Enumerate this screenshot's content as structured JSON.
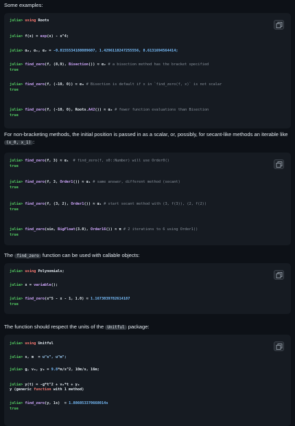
{
  "intro": "Some examples:",
  "para2": "For non-bracketing methods, the initial position is passed in as a scalar, or, possibly, for secant-like methods an iterable like ",
  "para2_code": "(x_0, x_1)",
  "para2_end": ":",
  "para3_pre": "The ",
  "para3_code": "find_zero",
  "para3_post": " function can be used with callable objects:",
  "para4_pre": "The function should respect the units of the ",
  "para4_code": "Unitful",
  "para4_post": " package:",
  "copy_icon": "copy-icon",
  "prompt": "julia>",
  "blocks": [
    {
      "lines": [
        [
          {
            "t": "julia> ",
            "c": "pr"
          },
          {
            "t": "using",
            "c": "kw"
          },
          {
            "t": " Roots",
            "c": "plain"
          }
        ],
        [
          {
            "t": "julia> ",
            "c": "pr"
          },
          {
            "t": "f(x) = ",
            "c": "plain"
          },
          {
            "t": "exp",
            "c": "fn"
          },
          {
            "t": "(x) - x^4;",
            "c": "plain"
          }
        ],
        [
          {
            "t": "julia> ",
            "c": "pr"
          },
          {
            "t": "α₀, α₁, α₂ = ",
            "c": "plain"
          },
          {
            "t": "-0.8155534188089607, 1.4296118247255556, 8.6131694564414;",
            "c": "num"
          }
        ],
        [
          {
            "t": "julia> ",
            "c": "pr"
          },
          {
            "t": "find_zero",
            "c": "fn"
          },
          {
            "t": "(f, (8,9), ",
            "c": "plain"
          },
          {
            "t": "Bisection",
            "c": "fn"
          },
          {
            "t": "()) ≈ α₂ ",
            "c": "plain"
          },
          {
            "t": "# a bisection method has the bracket specified",
            "c": "cm"
          }
        ],
        [
          {
            "t": "true",
            "c": "out"
          }
        ],
        [
          {
            "t": "julia> ",
            "c": "pr"
          },
          {
            "t": "find_zero",
            "c": "fn"
          },
          {
            "t": "(f, (-10, 0)) ≈ α₀ ",
            "c": "plain"
          },
          {
            "t": "# Bisection is default if x in `find_zero(f, x)` is not scalar",
            "c": "cm"
          }
        ],
        [
          {
            "t": "true",
            "c": "out"
          }
        ],
        [
          {
            "t": "julia> ",
            "c": "pr"
          },
          {
            "t": "find_zero",
            "c": "fn"
          },
          {
            "t": "(f, (-10, 0), Roots.",
            "c": "plain"
          },
          {
            "t": "A42",
            "c": "fn"
          },
          {
            "t": "()) ≈ α₀ ",
            "c": "plain"
          },
          {
            "t": "# fewer function evaluations than Bisection",
            "c": "cm"
          }
        ],
        [
          {
            "t": "true",
            "c": "out"
          }
        ]
      ]
    },
    {
      "lines": [
        [
          {
            "t": "julia> ",
            "c": "pr"
          },
          {
            "t": "find_zero",
            "c": "fn"
          },
          {
            "t": "(f, 3) ≈ α₁  ",
            "c": "plain"
          },
          {
            "t": "# find_zero(f, x0::Number) will use Order0()",
            "c": "cm"
          }
        ],
        [
          {
            "t": "true",
            "c": "out"
          }
        ],
        [
          {
            "t": "julia> ",
            "c": "pr"
          },
          {
            "t": "find_zero",
            "c": "fn"
          },
          {
            "t": "(f, 3, ",
            "c": "plain"
          },
          {
            "t": "Order1",
            "c": "fn"
          },
          {
            "t": "()) ≈ α₁ ",
            "c": "plain"
          },
          {
            "t": "# same answer, different method (secant)",
            "c": "cm"
          }
        ],
        [
          {
            "t": "true",
            "c": "out"
          }
        ],
        [
          {
            "t": "julia> ",
            "c": "pr"
          },
          {
            "t": "find_zero",
            "c": "fn"
          },
          {
            "t": "(f, (3, 2), ",
            "c": "plain"
          },
          {
            "t": "Order1",
            "c": "fn"
          },
          {
            "t": "()) ≈ α₁ ",
            "c": "plain"
          },
          {
            "t": "# start secant method with (3, f(3)), (2, f(2))",
            "c": "cm"
          }
        ],
        [
          {
            "t": "true",
            "c": "out"
          }
        ],
        [
          {
            "t": "julia> ",
            "c": "pr"
          },
          {
            "t": "find_zero",
            "c": "fn"
          },
          {
            "t": "(sin, ",
            "c": "plain"
          },
          {
            "t": "BigFloat",
            "c": "fn"
          },
          {
            "t": "(3.0), ",
            "c": "plain"
          },
          {
            "t": "Order16",
            "c": "fn"
          },
          {
            "t": "()) ≈ π ",
            "c": "plain"
          },
          {
            "t": "# 2 iterations to 6 using Order1()",
            "c": "cm"
          }
        ],
        [
          {
            "t": "true",
            "c": "out"
          }
        ]
      ]
    },
    {
      "lines": [
        [
          {
            "t": "julia> ",
            "c": "pr"
          },
          {
            "t": "using",
            "c": "kw"
          },
          {
            "t": " Polynomials;",
            "c": "plain"
          }
        ],
        [
          {
            "t": "julia> ",
            "c": "pr"
          },
          {
            "t": "x = ",
            "c": "plain"
          },
          {
            "t": "variable",
            "c": "fn"
          },
          {
            "t": "();",
            "c": "plain"
          }
        ],
        [
          {
            "t": "julia> ",
            "c": "pr"
          },
          {
            "t": "find_zero",
            "c": "fn"
          },
          {
            "t": "(x^5 - x - 1, 1.0) ≈ ",
            "c": "plain"
          },
          {
            "t": "1.1673039782614187",
            "c": "num"
          }
        ],
        [
          {
            "t": "true",
            "c": "out"
          }
        ]
      ]
    },
    {
      "lines": [
        [
          {
            "t": "julia> ",
            "c": "pr"
          },
          {
            "t": "using",
            "c": "kw"
          },
          {
            "t": " Unitful",
            "c": "plain"
          }
        ],
        [
          {
            "t": "julia> ",
            "c": "pr"
          },
          {
            "t": "s, m  = ",
            "c": "plain"
          },
          {
            "t": "u\"s\", u\"m\";",
            "c": "st"
          }
        ],
        [
          {
            "t": "julia> ",
            "c": "pr"
          },
          {
            "t": "g, v₀, y₀ = ",
            "c": "plain"
          },
          {
            "t": "9.8",
            "c": "num"
          },
          {
            "t": "*m/s^2, 10m/s, 16m;",
            "c": "plain"
          }
        ],
        [
          {
            "t": "julia> ",
            "c": "pr"
          },
          {
            "t": "y(t) = -g*t^2 + v₀*t + y₀",
            "c": "plain"
          }
        ],
        [
          {
            "t": "y (generic ",
            "c": "plain"
          },
          {
            "t": "function",
            "c": "kw"
          },
          {
            "t": " with 1 method)",
            "c": "plain"
          }
        ],
        [
          {
            "t": "julia> ",
            "c": "pr"
          },
          {
            "t": "find_zero",
            "c": "fn"
          },
          {
            "t": "(y, 1s)  ≈ ",
            "c": "plain"
          },
          {
            "t": "1.886053370668014s",
            "c": "num"
          }
        ],
        [
          {
            "t": "true",
            "c": "out"
          }
        ]
      ]
    }
  ]
}
